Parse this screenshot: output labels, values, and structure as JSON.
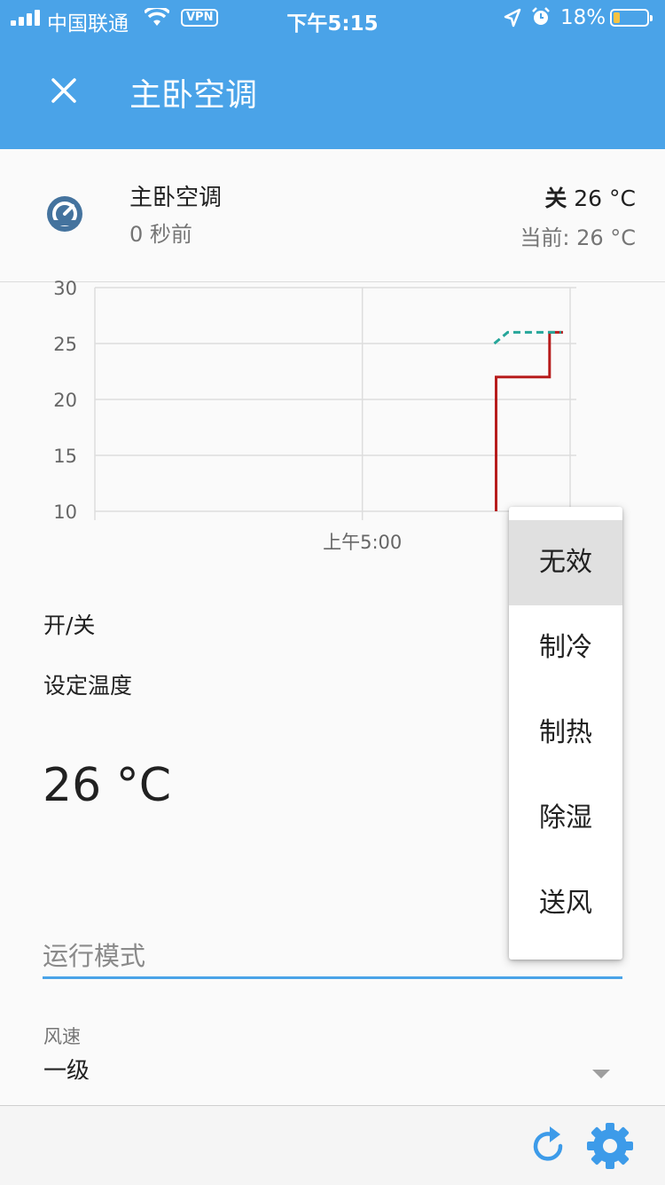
{
  "status_bar": {
    "carrier": "中国联通",
    "vpn": "VPN",
    "time": "下午5:15",
    "battery": "18%",
    "battery_level": 0.18
  },
  "app_bar": {
    "title": "主卧空调",
    "close_icon": "close-icon"
  },
  "entity": {
    "name": "主卧空调",
    "last_changed": "0 秒前",
    "state_label": "关",
    "target_temp": "26 °C",
    "current": "当前: 26 °C",
    "icon": "thermostat-icon"
  },
  "chart_data": {
    "type": "line",
    "ylim": [
      10,
      30
    ],
    "y_ticks": [
      "30",
      "25",
      "20",
      "15",
      "10"
    ],
    "x_ticks": [
      "上午5:00"
    ],
    "grid": true,
    "legend": "none",
    "series": [
      {
        "color": "#b71c1c",
        "style": "solid",
        "x": [
          "17:10",
          "17:10",
          "17:14",
          "17:14",
          "17:15"
        ],
        "values": [
          10,
          22,
          22,
          26,
          26
        ]
      },
      {
        "color": "#26a69a",
        "style": "dashed",
        "x": [
          "17:10",
          "17:11",
          "17:14",
          "17:15"
        ],
        "values": [
          25,
          26,
          26,
          26
        ]
      }
    ]
  },
  "controls": {
    "power_label": "开/关",
    "set_temp_label": "设定温度",
    "set_temp_value": "26 °C",
    "mode_placeholder": "运行模式",
    "fan_label": "风速",
    "fan_value": "一级"
  },
  "mode_menu": {
    "options": [
      "无效",
      "制冷",
      "制热",
      "除湿",
      "送风"
    ],
    "selected": "无效"
  },
  "footer": {
    "refresh_icon": "refresh-icon",
    "settings_icon": "gear-icon"
  },
  "colors": {
    "primary": "#4aa3e8",
    "series_target": "#b71c1c",
    "series_current": "#26a69a"
  }
}
